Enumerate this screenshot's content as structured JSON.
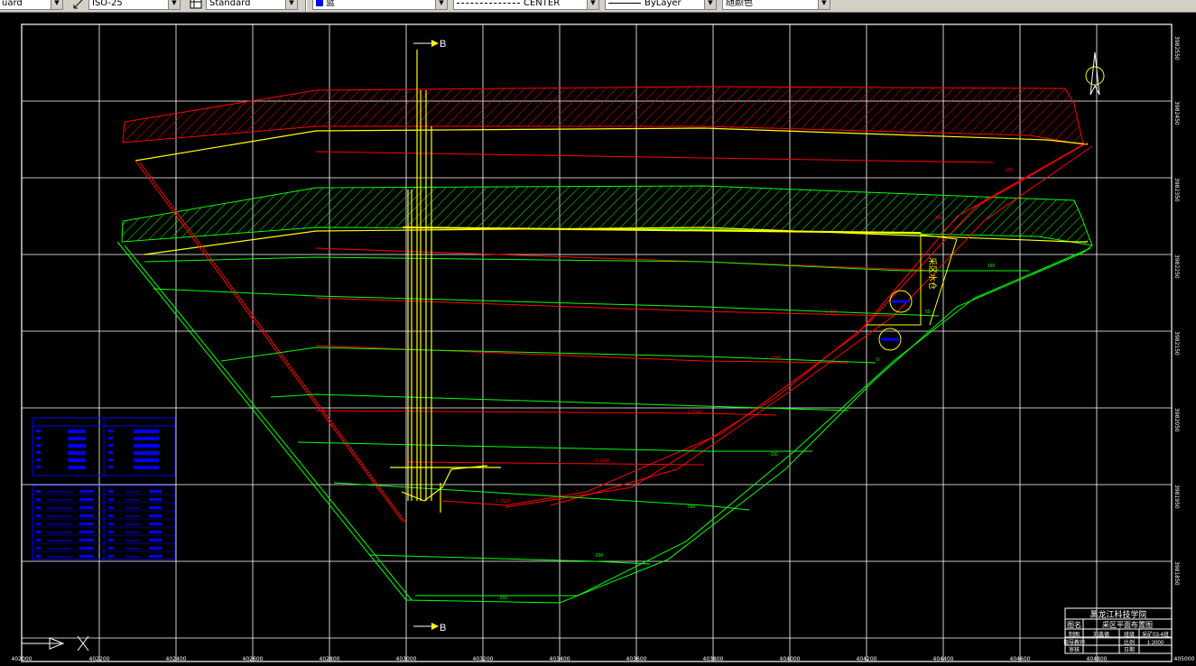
{
  "toolbar": {
    "textstyle_value": "uard",
    "dimstyle_value": "ISO-25",
    "tablestyle_value": "Standard",
    "layer_value": "蓝",
    "linetype_value": "CENTER",
    "lineweight_value": "ByLayer",
    "color_value": "随颜色"
  },
  "drawing": {
    "section_label_top": "B",
    "section_label_bottom": "B",
    "x_axis_labels": [
      "402000",
      "402200",
      "402400",
      "402600",
      "402800",
      "403000",
      "403200",
      "403400",
      "403600",
      "403800",
      "404000",
      "404200",
      "404400",
      "404600",
      "404800",
      "405000"
    ],
    "y_axis_labels": [
      "3982550",
      "3982450",
      "3982350",
      "3982250",
      "3982150",
      "3982050",
      "3981950",
      "3981850"
    ],
    "contour_labels": [
      "-150",
      "-250",
      "L-300",
      "L-1000",
      "L-1500",
      "L-2000",
      "L-2500",
      "-100",
      "-160",
      "-200",
      "-250",
      "150",
      "0",
      "50"
    ],
    "vertical_text": "采区水仓"
  },
  "title_block": {
    "institution": "黑龙江科技学院",
    "name_label": "图名",
    "drawing_name": "采区平面布置图",
    "row2": [
      "制图",
      "刘鑫德",
      "班级",
      "采矿03-4班"
    ],
    "row3": [
      "指导教师",
      "",
      "比例",
      "1:2000"
    ],
    "row4": [
      "审核",
      "",
      "日期",
      ""
    ]
  },
  "colors": {
    "background": "#000000",
    "grid": "#ffffff",
    "red": "#ff0000",
    "green": "#00ff00",
    "yellow": "#ffff00",
    "blue": "#0000ff"
  }
}
